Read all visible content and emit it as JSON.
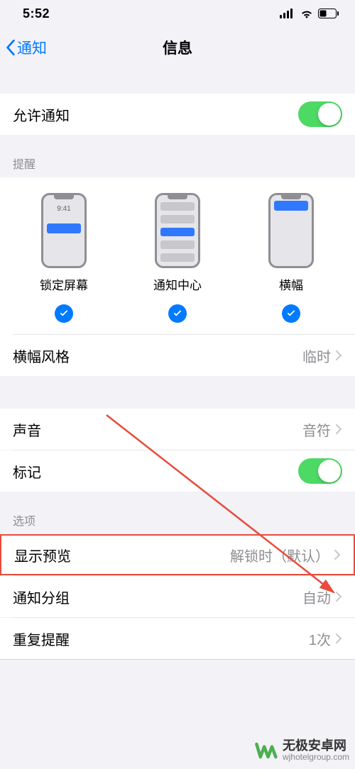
{
  "status": {
    "time": "5:52"
  },
  "nav": {
    "back": "通知",
    "title": "信息"
  },
  "allow": {
    "label": "允许通知"
  },
  "alerts": {
    "header": "提醒",
    "sample_time": "9:41",
    "items": [
      {
        "label": "锁定屏幕"
      },
      {
        "label": "通知中心"
      },
      {
        "label": "横幅"
      }
    ],
    "banner_style": {
      "label": "横幅风格",
      "value": "临时"
    }
  },
  "sounds": {
    "label": "声音",
    "value": "音符"
  },
  "badges": {
    "label": "标记"
  },
  "options": {
    "header": "选项",
    "preview": {
      "label": "显示预览",
      "value": "解锁时（默认）"
    },
    "grouping": {
      "label": "通知分组",
      "value": "自动"
    },
    "repeat": {
      "label": "重复提醒",
      "value": "1次"
    }
  },
  "watermark": {
    "name": "无极安卓网",
    "url": "wjhotelgroup.com"
  }
}
